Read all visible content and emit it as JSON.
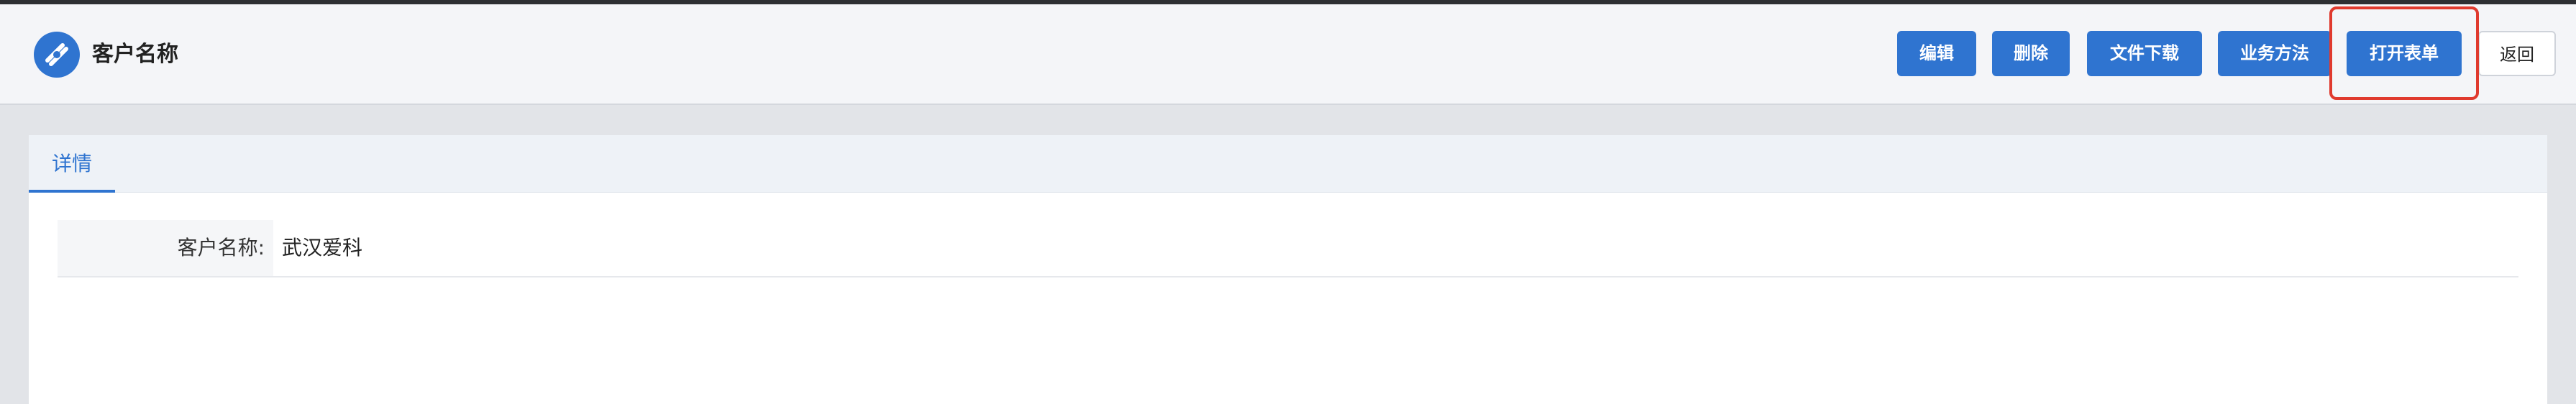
{
  "header": {
    "title": "客户名称",
    "logo_icon": "app-logo-icon",
    "accent_color": "#2f74d0"
  },
  "toolbar": {
    "edit_label": "编辑",
    "delete_label": "删除",
    "download_label": "文件下载",
    "business_label": "业务方法",
    "open_form_label": "打开表单",
    "back_label": "返回",
    "highlight_color": "#e03a2e"
  },
  "tabs": [
    {
      "label": "详情",
      "active": true
    }
  ],
  "detail": {
    "fields": [
      {
        "label": "客户名称:",
        "value": "武汉爱科"
      }
    ]
  }
}
